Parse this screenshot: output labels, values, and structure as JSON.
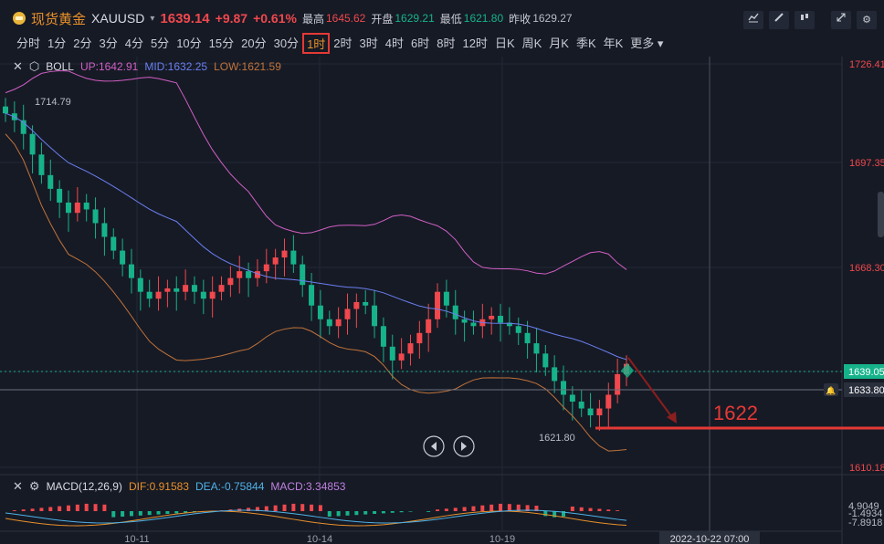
{
  "header": {
    "instrument_name": "现货黄金",
    "symbol": "XAUUSD",
    "last_price": "1639.14",
    "change": "+9.87",
    "change_pct": "+0.61%",
    "high_label": "最高",
    "high_value": "1645.62",
    "open_label": "开盘",
    "open_value": "1629.21",
    "low_label": "最低",
    "low_value": "1621.80",
    "prev_close_label": "昨收",
    "prev_close_value": "1629.27"
  },
  "timeframes": [
    "分时",
    "1分",
    "2分",
    "3分",
    "4分",
    "5分",
    "10分",
    "15分",
    "20分",
    "30分",
    "1时",
    "2时",
    "3时",
    "4时",
    "6时",
    "8时",
    "12时",
    "日K",
    "周K",
    "月K",
    "季K",
    "年K",
    "更多"
  ],
  "active_timeframe": "1时",
  "toolbar_icons": [
    "indicator-icon",
    "draw-icon",
    "candle-type-icon",
    "expand-icon",
    "settings-icon"
  ],
  "boll_legend": {
    "name": "BOLL",
    "up": "UP:1642.91",
    "mid": "MID:1632.25",
    "low": "LOW:1621.59"
  },
  "macd_legend": {
    "name": "MACD(12,26,9)",
    "dif": "DIF:0.91583",
    "dea": "DEA:-0.75844",
    "macd": "MACD:3.34853"
  },
  "colors": {
    "up": "#f0484d",
    "down": "#16b38a",
    "boll_up": "#d15fc4",
    "boll_mid": "#6a7ff0",
    "boll_low": "#c0733a",
    "annotation": "#e53935"
  },
  "chart_data": {
    "type": "candlestick",
    "price_axis_labels": [
      "1726.41",
      "1697.35",
      "1668.30",
      "1610.18"
    ],
    "current_price_tag": "1639.05",
    "crosshair_price_tag": "1633.80",
    "high_marker": "1714.79",
    "low_marker": "1621.80",
    "annotation_level": "1622",
    "x_labels": [
      "10-11",
      "10-14",
      "10-19"
    ],
    "crosshair_time": "2022-10-22 07:00",
    "macd_axis_labels": [
      "4.9049",
      "-1.4934",
      "-7.8918"
    ],
    "close_series": [
      1712,
      1710,
      1706,
      1700,
      1694,
      1690,
      1686,
      1683,
      1686,
      1684,
      1680,
      1676,
      1672,
      1668,
      1664,
      1660,
      1658,
      1660,
      1661,
      1660,
      1662,
      1660,
      1658,
      1660,
      1662,
      1664,
      1666,
      1664,
      1666,
      1668,
      1670,
      1672,
      1668,
      1662,
      1656,
      1652,
      1650,
      1652,
      1655,
      1657,
      1656,
      1650,
      1644,
      1640,
      1642,
      1645,
      1648,
      1652,
      1660,
      1656,
      1652,
      1651,
      1650,
      1652,
      1653,
      1651,
      1650,
      1648,
      1645,
      1642,
      1638,
      1634,
      1630,
      1628,
      1626,
      1624,
      1626,
      1630,
      1636,
      1639
    ],
    "boll": {
      "up": "1642.91",
      "mid": "1632.25",
      "low": "1621.59"
    },
    "macd": {
      "dif": "0.91583",
      "dea": "-0.75844",
      "macd": "3.34853"
    }
  }
}
